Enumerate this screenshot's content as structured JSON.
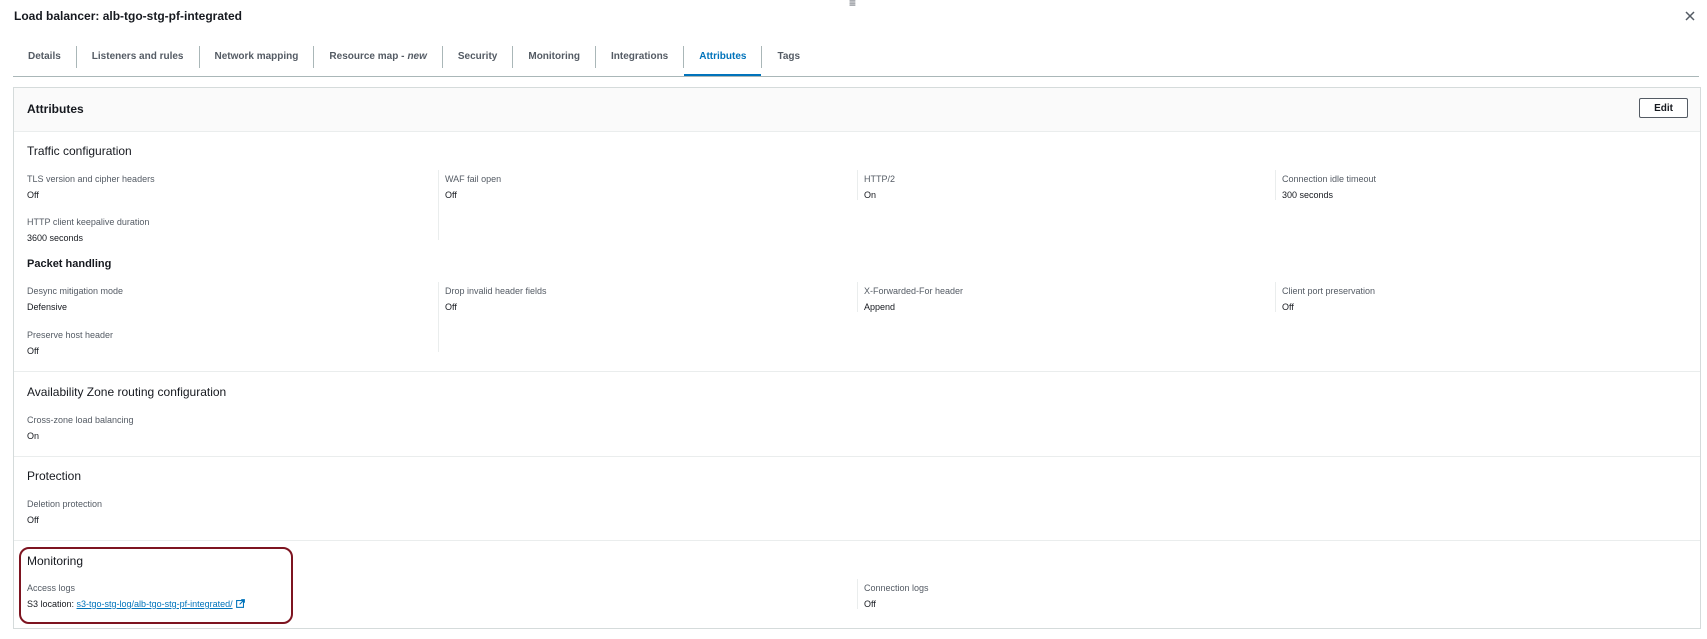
{
  "header": {
    "title": "Load balancer: alb-tgo-stg-pf-integrated",
    "drag_glyph": "≡"
  },
  "tabs": [
    {
      "label": "Details"
    },
    {
      "label": "Listeners and rules"
    },
    {
      "label": "Network mapping"
    },
    {
      "label": "Resource map - ",
      "suffix": "new"
    },
    {
      "label": "Security"
    },
    {
      "label": "Monitoring"
    },
    {
      "label": "Integrations"
    },
    {
      "label": "Attributes",
      "active": true
    },
    {
      "label": "Tags"
    }
  ],
  "panel": {
    "title": "Attributes",
    "edit_label": "Edit"
  },
  "traffic": {
    "title": "Traffic configuration",
    "fields": [
      {
        "label": "TLS version and cipher headers",
        "value": "Off"
      },
      {
        "label": "WAF fail open",
        "value": "Off"
      },
      {
        "label": "HTTP/2",
        "value": "On"
      },
      {
        "label": "Connection idle timeout",
        "value": "300 seconds"
      },
      {
        "label": "HTTP client keepalive duration",
        "value": "3600 seconds"
      }
    ]
  },
  "packet": {
    "title": "Packet handling",
    "fields": [
      {
        "label": "Desync mitigation mode",
        "value": "Defensive"
      },
      {
        "label": "Drop invalid header fields",
        "value": "Off"
      },
      {
        "label": "X-Forwarded-For header",
        "value": "Append"
      },
      {
        "label": "Client port preservation",
        "value": "Off"
      },
      {
        "label": "Preserve host header",
        "value": "Off"
      }
    ]
  },
  "az": {
    "title": "Availability Zone routing configuration",
    "fields": [
      {
        "label": "Cross-zone load balancing",
        "value": "On"
      }
    ]
  },
  "protection": {
    "title": "Protection",
    "fields": [
      {
        "label": "Deletion protection",
        "value": "Off"
      }
    ]
  },
  "monitoring": {
    "title": "Monitoring",
    "access_logs_label": "Access logs",
    "s3_prefix": "S3 location: ",
    "s3_link": "s3-tgo-stg-log/alb-tgo-stg-pf-integrated/",
    "connection_logs_label": "Connection logs",
    "connection_logs_value": "Off"
  },
  "colors": {
    "accent": "#0073bb",
    "highlight": "#7d1420"
  }
}
